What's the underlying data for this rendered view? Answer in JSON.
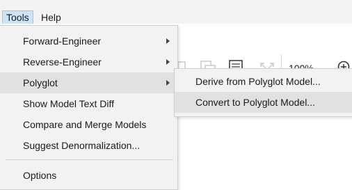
{
  "menubar": {
    "items": [
      {
        "label": "Tools"
      },
      {
        "label": "Help"
      }
    ]
  },
  "toolbar": {
    "zoom_label": "100%",
    "icons": [
      "page-icon",
      "copy-document-icon",
      "report-search-icon",
      "fit-to-screen-icon",
      "zoom-in-icon"
    ]
  },
  "tools_menu": {
    "items": [
      {
        "label": "Forward-Engineer",
        "has_submenu": true
      },
      {
        "label": "Reverse-Engineer",
        "has_submenu": true
      },
      {
        "label": "Polyglot",
        "has_submenu": true,
        "highlighted": true
      },
      {
        "label": "Show Model Text Diff"
      },
      {
        "label": "Compare and Merge Models"
      },
      {
        "label": "Suggest Denormalization..."
      },
      {
        "label": "Options"
      }
    ]
  },
  "polyglot_submenu": {
    "items": [
      {
        "label": "Derive from Polyglot Model..."
      },
      {
        "label": "Convert to Polyglot Model...",
        "highlighted": true
      }
    ]
  },
  "colors": {
    "menubar_bg": "#f3f3f3",
    "menu_bg": "#f2f2f2",
    "highlight": "#e1e1e1",
    "active_menu": "#cce4f7"
  }
}
